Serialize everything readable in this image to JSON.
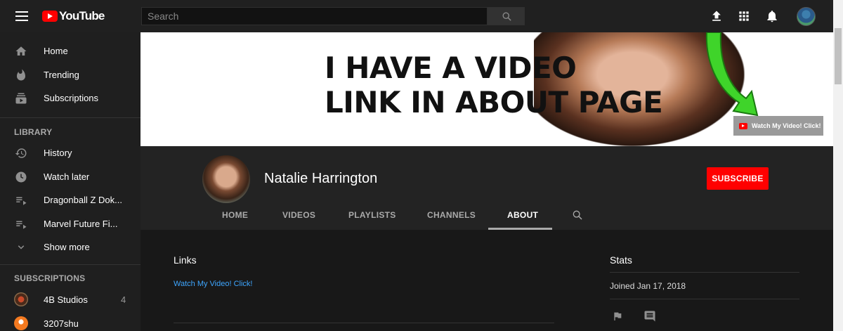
{
  "app": {
    "logo_text": "YouTube",
    "search_placeholder": "Search"
  },
  "topbar_icons": [
    "menu-icon",
    "search-icon",
    "upload-icon",
    "apps-icon",
    "notifications-icon",
    "account-avatar"
  ],
  "sidebar": {
    "main": [
      {
        "label": "Home",
        "icon": "home-icon"
      },
      {
        "label": "Trending",
        "icon": "trending-icon"
      },
      {
        "label": "Subscriptions",
        "icon": "subscriptions-icon"
      }
    ],
    "library_heading": "LIBRARY",
    "library": [
      {
        "label": "History",
        "icon": "history-icon"
      },
      {
        "label": "Watch later",
        "icon": "watch-later-icon"
      },
      {
        "label": "Dragonball Z Dok...",
        "icon": "playlist-icon"
      },
      {
        "label": "Marvel Future Fi...",
        "icon": "playlist-icon"
      },
      {
        "label": "Show more",
        "icon": "chevron-down-icon"
      }
    ],
    "subscriptions_heading": "SUBSCRIPTIONS",
    "subscriptions": [
      {
        "label": "4B Studios",
        "count": "4"
      },
      {
        "label": "3207shu",
        "count": ""
      }
    ]
  },
  "banner": {
    "line1": "I HAVE A VIDEO",
    "line2": "LINK IN ABOUT PAGE",
    "link_label": "Watch My Video! Click!"
  },
  "channel": {
    "name": "Natalie Harrington",
    "subscribe_label": "SUBSCRIBE",
    "tabs": [
      "HOME",
      "VIDEOS",
      "PLAYLISTS",
      "CHANNELS",
      "ABOUT"
    ],
    "active_tab": "ABOUT"
  },
  "about": {
    "links_heading": "Links",
    "link_text": "Watch My Video! Click!",
    "stats_heading": "Stats",
    "joined": "Joined Jan 17, 2018"
  },
  "colors": {
    "brand_red": "#ff0000",
    "link_blue": "#3ea6ff",
    "background": "#181818",
    "sidebar_bg": "#1f1f1f"
  }
}
